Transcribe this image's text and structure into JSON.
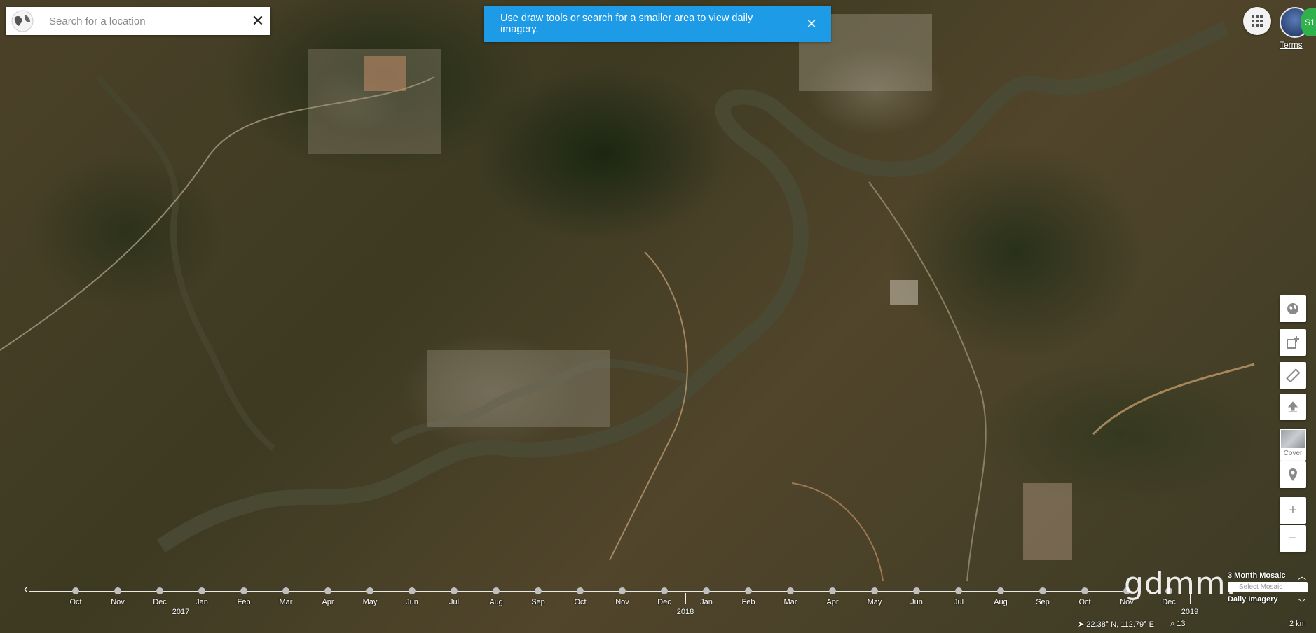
{
  "search": {
    "placeholder": "Search for a location",
    "close_icon": "close-icon"
  },
  "banner": {
    "message": "Use draw tools or search for a smaller area to view daily imagery.",
    "close_icon": "close-icon"
  },
  "header": {
    "terms_label": "Terms",
    "apps_icon": "grid-icon",
    "avatar_badge": "S1"
  },
  "toolbar": {
    "items": [
      {
        "icon": "globe-icon"
      },
      {
        "icon": "draw-shape-icon"
      },
      {
        "icon": "ruler-icon"
      },
      {
        "icon": "upload-icon"
      },
      {
        "icon": "cover-thumbnail",
        "label": "Cover"
      },
      {
        "icon": "pin-icon"
      },
      {
        "icon": "zoom-in-icon"
      },
      {
        "icon": "zoom-out-icon"
      }
    ]
  },
  "timeline": {
    "months": [
      "Oct",
      "Nov",
      "Dec",
      "Jan",
      "Feb",
      "Mar",
      "Apr",
      "May",
      "Jun",
      "Jul",
      "Aug",
      "Sep",
      "Oct",
      "Nov",
      "Dec",
      "Jan",
      "Feb",
      "Mar",
      "Apr",
      "May",
      "Jun",
      "Jul",
      "Aug",
      "Sep",
      "Oct",
      "Nov",
      "Dec"
    ],
    "years": [
      "2017",
      "2018",
      "2019"
    ]
  },
  "mosaic": {
    "title": "3 Month Mosaic",
    "field_placeholder": "Select Mosaic",
    "daily_label": "Daily Imagery"
  },
  "status": {
    "coords": "22.38° N, 112.79° E",
    "zoom_level": "13",
    "scale": "2 km"
  },
  "watermark": "gdmm."
}
